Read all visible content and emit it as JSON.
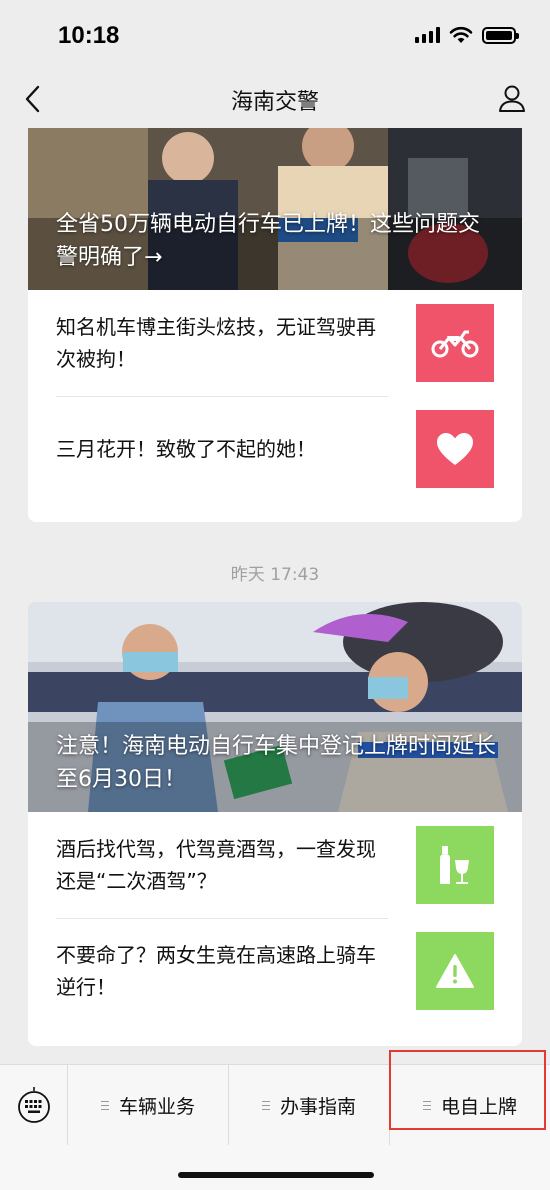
{
  "status_bar": {
    "time": "10:18"
  },
  "nav": {
    "title": "海南交警"
  },
  "feed": {
    "group_1": {
      "hero_title": "全省50万辆电动自行车已上牌！这些问题交警明确了→",
      "items": [
        {
          "title": "知名机车博主街头炫技，无证驾驶再次被拘！",
          "thumb_color": "#f0546b",
          "icon": "motorcycle-icon"
        },
        {
          "title": "三月花开！致敬了不起的她！",
          "thumb_color": "#f0546b",
          "icon": "heart-icon"
        }
      ]
    },
    "timestamp": "昨天 17:43",
    "group_2": {
      "hero_title": "注意！海南电动自行车集中登记上牌时间延长至6月30日！",
      "items": [
        {
          "title": "酒后找代驾，代驾竟酒驾，一查发现还是“二次酒驾”？",
          "thumb_color": "#8dd95f",
          "icon": "wine-bottle-icon"
        },
        {
          "title": "不要命了？两女生竟在高速路上骑车逆行！",
          "thumb_color": "#8dd95f",
          "icon": "warning-icon"
        }
      ]
    }
  },
  "bottom_menu": {
    "items": [
      {
        "label": "车辆业务"
      },
      {
        "label": "办事指南"
      },
      {
        "label": "电自上牌"
      }
    ],
    "highlighted_item": "电自上牌",
    "highlight_color": "#e53935"
  }
}
